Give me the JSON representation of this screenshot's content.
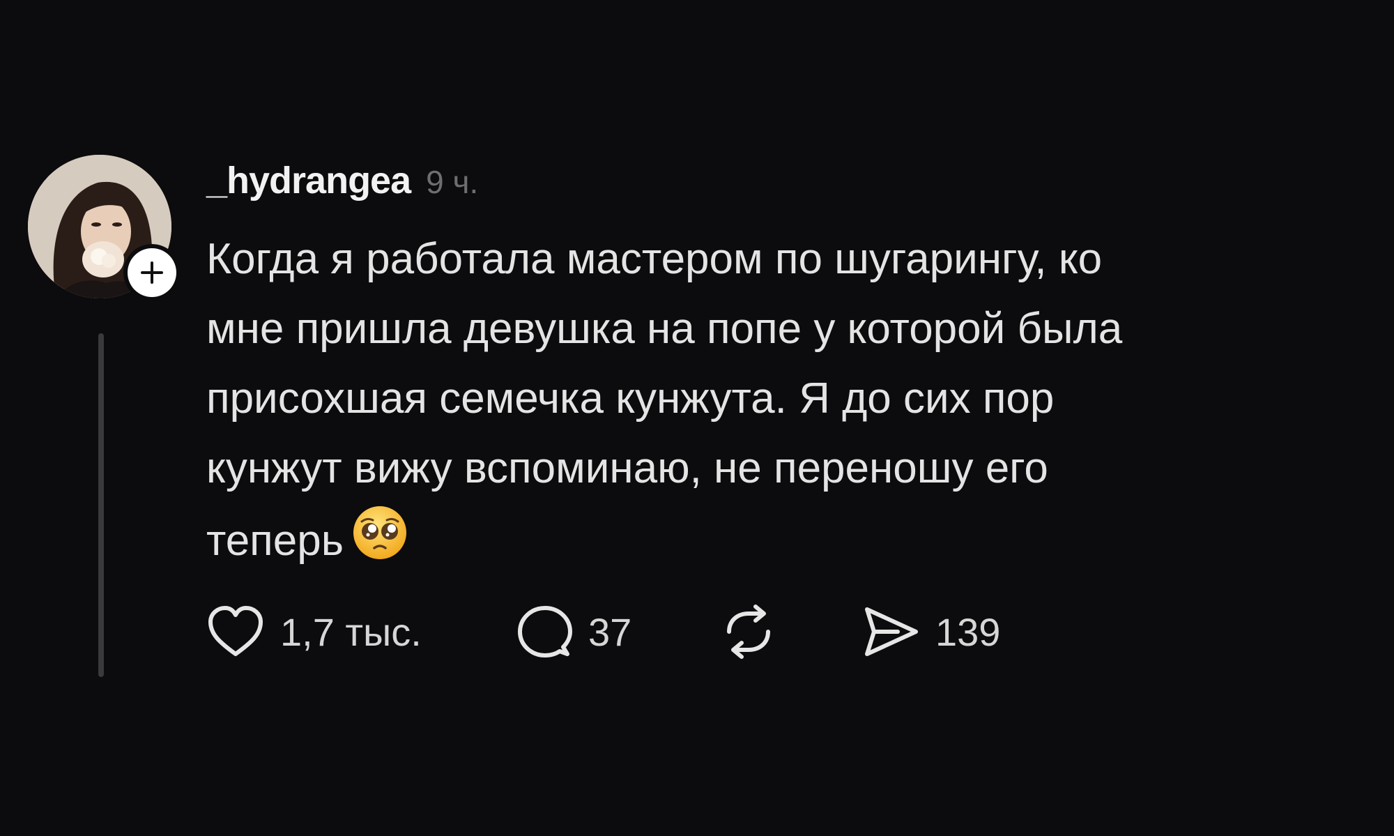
{
  "post": {
    "username": "_hydrangea",
    "time": "9 ч.",
    "text_lines": [
      "Когда я работала мастером по шугарингу, ко",
      "мне пришла девушка на попе у которой была",
      "присохшая семечка кунжута. Я до сих пор",
      "кунжут вижу вспоминаю, не переношу его",
      "теперь"
    ],
    "emoji": "pleading-face",
    "actions": {
      "likes": "1,7 тыс.",
      "replies": "37",
      "shares": "139"
    }
  },
  "icons": {
    "like": "heart-icon",
    "reply": "comment-bubble-icon",
    "repost": "repost-arrows-icon",
    "share": "send-icon",
    "follow": "plus-icon"
  },
  "colors": {
    "background": "#0c0b0d",
    "text": "#e4e4e4",
    "muted": "#6e6e72",
    "thread_line": "#3a3a3d"
  }
}
